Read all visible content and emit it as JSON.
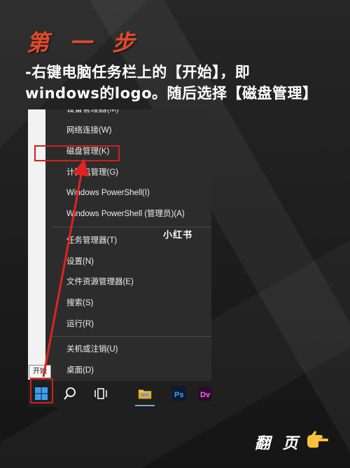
{
  "header": {
    "step_title": "第 一 步",
    "instruction_line1": "-右键电脑任务栏上的【开始】，即",
    "instruction_line2": "windows的logo。随后选择【磁盘管理】"
  },
  "menu": {
    "cut_item": "设备管理器(M)",
    "network": "网络连接(W)",
    "disk_management": "磁盘管理(K)",
    "computer_management": "计算机管理(G)",
    "powershell": "Windows PowerShell(I)",
    "powershell_admin": "Windows PowerShell (管理员)(A)",
    "task_manager": "任务管理器(T)",
    "settings": "设置(N)",
    "file_explorer": "文件资源管理器(E)",
    "search": "搜索(S)",
    "run": "运行(R)",
    "shutdown": "关机或注销(U)",
    "desktop": "桌面(D)"
  },
  "watermark": "小红书",
  "tooltip": "开始",
  "taskbar": {
    "icons": [
      "windows-start-icon",
      "search-icon",
      "task-view-icon",
      "file-explorer-icon",
      "photoshop-icon",
      "dreamweaver-icon"
    ],
    "ps_label": "Ps",
    "dw_label": "Dv"
  },
  "footer": {
    "next_page": "翻 页",
    "icon": "pointing-hand-icon"
  },
  "colors": {
    "accent_red": "#d0201d",
    "title_orange": "#e24a2b",
    "menu_bg": "#2c2c2c"
  }
}
